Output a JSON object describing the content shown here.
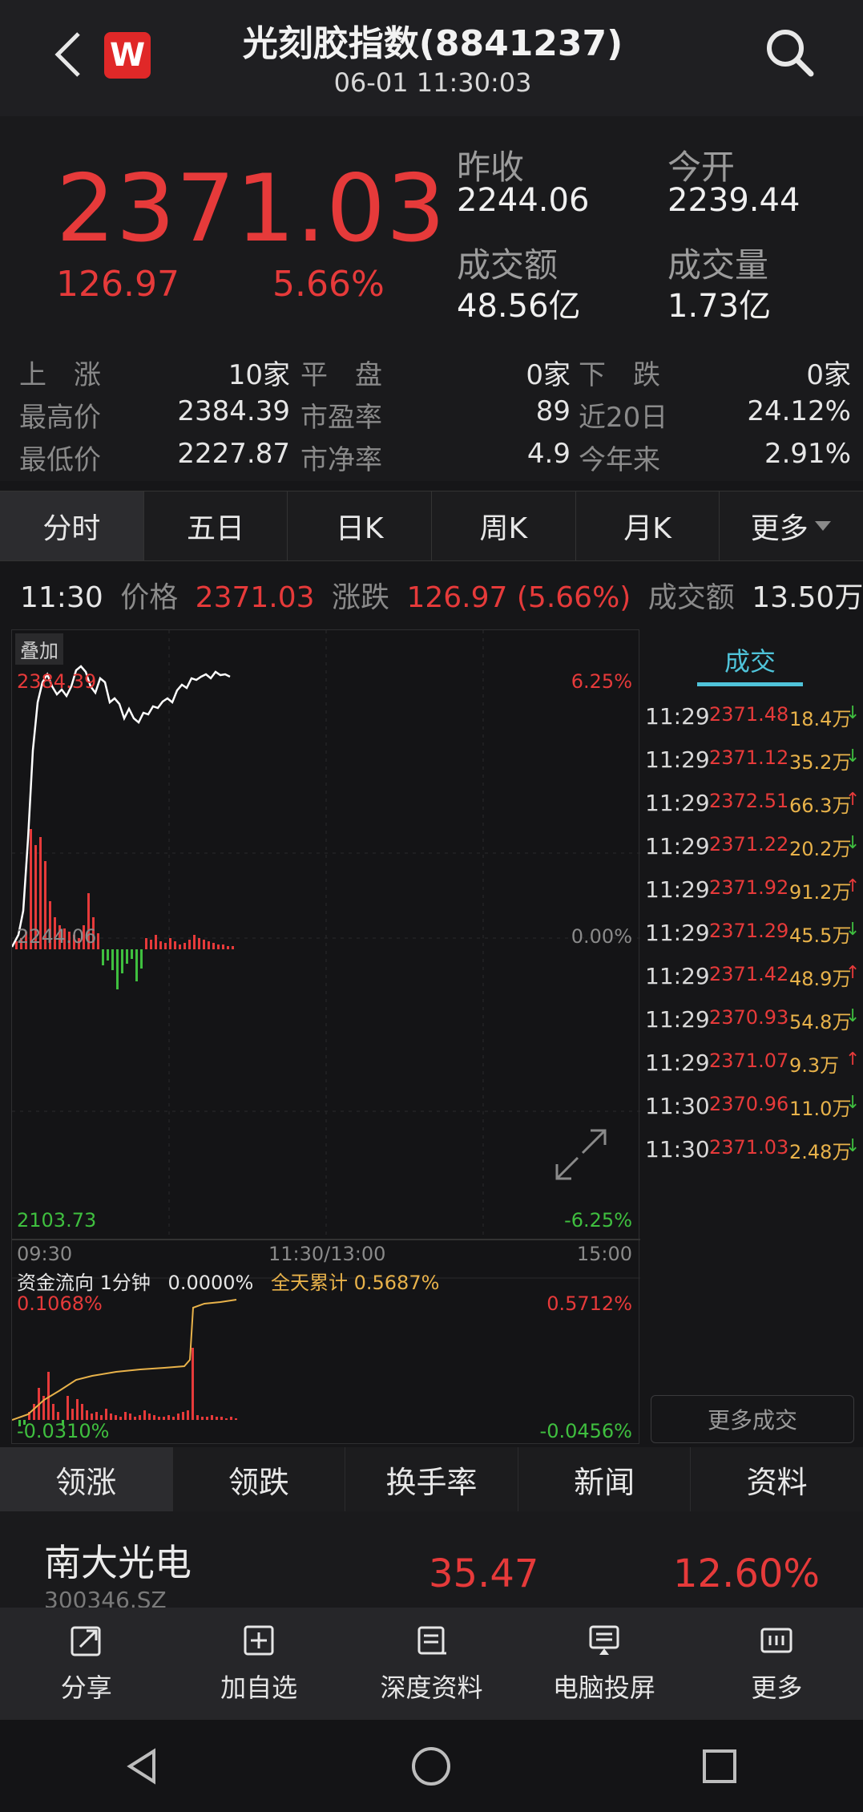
{
  "header": {
    "title": "光刻胶指数(8841237)",
    "datetime": "06-01 11:30:03",
    "logo_letter": "W"
  },
  "quote": {
    "price": "2371.03",
    "change": "126.97",
    "change_pct": "5.66%",
    "prev_close_label": "昨收",
    "prev_close": "2244.06",
    "open_label": "今开",
    "open": "2239.44",
    "turnover_label": "成交额",
    "turnover": "48.56亿",
    "volume_label": "成交量",
    "volume": "1.73亿"
  },
  "stats": {
    "up_label": "上　涨",
    "up": "10家",
    "flat_label": "平　盘",
    "flat": "0家",
    "down_label": "下　跌",
    "down": "0家",
    "high_label": "最高价",
    "high": "2384.39",
    "pe_label": "市盈率",
    "pe": "89",
    "d20_label": "近20日",
    "d20": "24.12%",
    "low_label": "最低价",
    "low": "2227.87",
    "pb_label": "市净率",
    "pb": "4.9",
    "ytd_label": "今年来",
    "ytd": "2.91%"
  },
  "chart_tabs": [
    "分时",
    "五日",
    "日K",
    "周K",
    "月K",
    "更多"
  ],
  "info": {
    "time": "11:30",
    "price_label": "价格",
    "price": "2371.03",
    "chg_label": "涨跌",
    "chg": "126.97 (5.66%)",
    "amount_label": "成交额",
    "amount": "13.50万"
  },
  "chart": {
    "overlay_label": "叠加",
    "top_price": "2384.39",
    "top_pct": "6.25%",
    "mid_price": "2244.06",
    "mid_pct": "0.00%",
    "bottom_price": "2103.73",
    "bottom_pct": "-6.25%",
    "time_start": "09:30",
    "time_mid": "11:30/13:00",
    "time_end": "15:00",
    "flow_title": "资金流向 1分钟",
    "flow_value": "0.0000%",
    "flow_total_label": "全天累计",
    "flow_total": "0.5687%",
    "flow_left_top": "0.1068%",
    "flow_right_top": "0.5712%",
    "flow_left_bottom": "-0.0310%",
    "flow_right_bottom": "-0.0456%",
    "colors": {
      "line": "#ffffff",
      "up": "#e63a3a",
      "down": "#3fbf3f",
      "flow": "#e8b24a"
    }
  },
  "trades": {
    "tab_label": "成交",
    "more_label": "更多成交",
    "rows": [
      {
        "time": "11:29",
        "price": "2371.48",
        "vol": "18.4万",
        "dir": "down"
      },
      {
        "time": "11:29",
        "price": "2371.12",
        "vol": "35.2万",
        "dir": "down"
      },
      {
        "time": "11:29",
        "price": "2372.51",
        "vol": "66.3万",
        "dir": "up"
      },
      {
        "time": "11:29",
        "price": "2371.22",
        "vol": "20.2万",
        "dir": "down"
      },
      {
        "time": "11:29",
        "price": "2371.92",
        "vol": "91.2万",
        "dir": "up"
      },
      {
        "time": "11:29",
        "price": "2371.29",
        "vol": "45.5万",
        "dir": "down"
      },
      {
        "time": "11:29",
        "price": "2371.42",
        "vol": "48.9万",
        "dir": "up"
      },
      {
        "time": "11:29",
        "price": "2370.93",
        "vol": "54.8万",
        "dir": "down"
      },
      {
        "time": "11:29",
        "price": "2371.07",
        "vol": "9.3万",
        "dir": "up"
      },
      {
        "time": "11:30",
        "price": "2370.96",
        "vol": "11.0万",
        "dir": "down"
      },
      {
        "time": "11:30",
        "price": "2371.03",
        "vol": "2.48万",
        "dir": "down"
      }
    ]
  },
  "bottom_tabs": [
    "领涨",
    "领跌",
    "换手率",
    "新闻",
    "资料"
  ],
  "stock": {
    "name": "南大光电",
    "code": "300346.SZ",
    "price": "35.47",
    "pct": "12.60%"
  },
  "toolbar": [
    {
      "label": "分享",
      "icon": "share-icon"
    },
    {
      "label": "加自选",
      "icon": "add-watchlist-icon"
    },
    {
      "label": "深度资料",
      "icon": "book-icon"
    },
    {
      "label": "电脑投屏",
      "icon": "cast-icon"
    },
    {
      "label": "更多",
      "icon": "more-icon"
    }
  ]
}
